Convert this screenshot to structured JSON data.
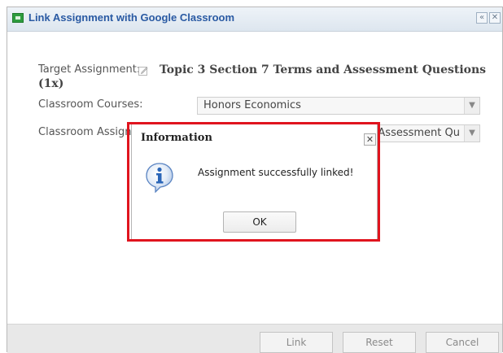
{
  "window": {
    "title": "Link Assignment with Google Classroom",
    "collapse_glyph": "«",
    "close_glyph": "✕"
  },
  "form": {
    "target_label": "Target Assignment:",
    "target_value": "Topic 3 Section 7 Terms and Assessment Questions (1x)",
    "courses_label": "Classroom Courses:",
    "courses_value": "Honors Economics",
    "assignment_label": "Classroom Assignment:",
    "assignment_value": "Topic 3 Section 7 Terms and Assessment Qu"
  },
  "footer": {
    "link_label": "Link",
    "reset_label": "Reset",
    "cancel_label": "Cancel"
  },
  "dialog": {
    "title": "Information",
    "message": "Assignment successfully linked!",
    "ok_label": "OK",
    "close_glyph": "✕",
    "icon": "info-icon"
  },
  "colors": {
    "title_blue": "#2a5aa3",
    "highlight_red": "#e0141e",
    "info_blue": "#2b66b8"
  }
}
